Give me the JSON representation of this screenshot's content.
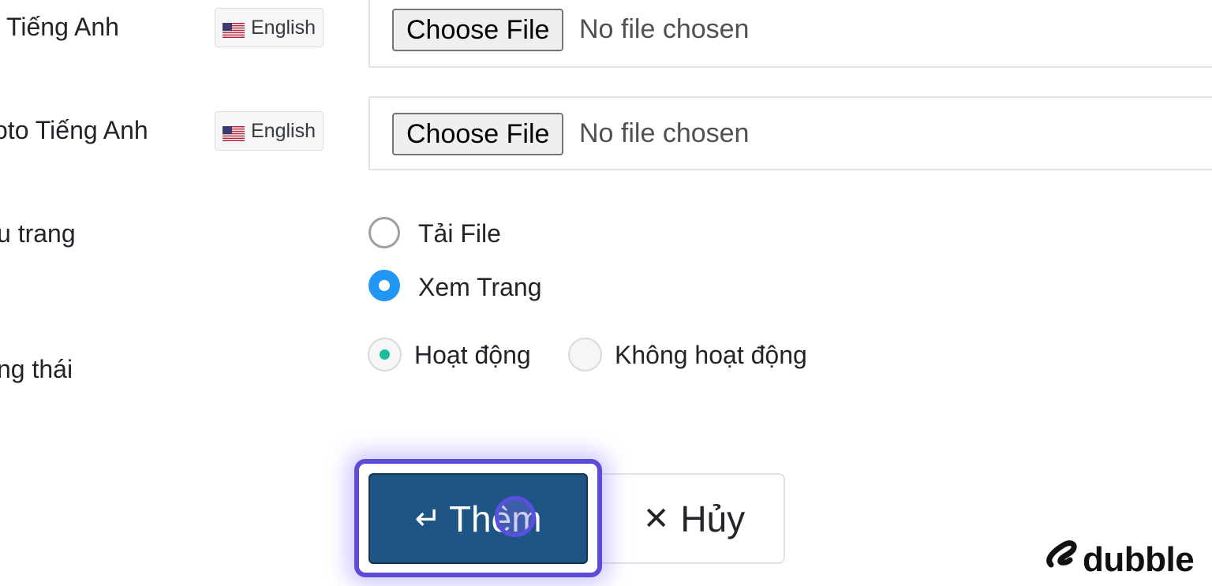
{
  "form": {
    "rows": [
      {
        "label": "Tiếng Anh",
        "lang": "English",
        "file_button": "Choose File",
        "file_status": "No file chosen"
      },
      {
        "label": "oto Tiếng Anh",
        "lang": "English",
        "file_button": "Choose File",
        "file_status": "No file chosen"
      }
    ],
    "page_type": {
      "label": "u trang",
      "options": [
        {
          "label": "Tải File",
          "selected": false
        },
        {
          "label": "Xem Trang",
          "selected": true
        }
      ]
    },
    "status": {
      "label": "ng thái",
      "options": [
        {
          "label": "Hoạt động",
          "selected": true
        },
        {
          "label": "Không hoạt động",
          "selected": false
        }
      ]
    },
    "actions": {
      "submit_label": "Thêm",
      "submit_icon": "enter-icon",
      "cancel_label": "Hủy",
      "cancel_icon": "close-icon"
    }
  },
  "brand": {
    "name": "dubble"
  },
  "colors": {
    "primary": "#1f5585",
    "radio_checked": "#2196f3",
    "status_dot": "#1abc9c",
    "focus_ring": "#5b4bd6"
  }
}
